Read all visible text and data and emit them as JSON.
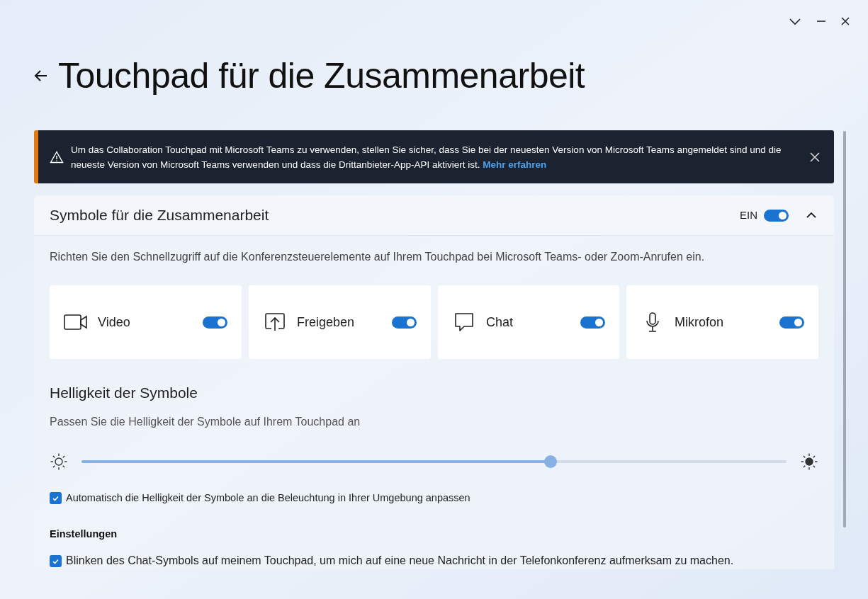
{
  "window": {
    "title": "Touchpad für die Zusammenarbeit"
  },
  "banner": {
    "message": "Um das Collaboration Touchpad mit Microsoft Teams zu verwenden, stellen Sie sicher, dass Sie bei der neuesten Version von Microsoft Teams angemeldet sind und die neueste Version von Microsoft Teams verwenden und dass die Drittanbieter-App-API aktiviert ist.",
    "link": "Mehr erfahren"
  },
  "section": {
    "title": "Symbole für die Zusammenarbeit",
    "state_label": "EIN",
    "on": true,
    "expanded": true,
    "description": "Richten Sie den Schnellzugriff auf die Konferenzsteuerelemente auf Ihrem Touchpad bei Microsoft Teams- oder Zoom-Anrufen ein.",
    "tiles": [
      {
        "kind": "video",
        "label": "Video",
        "on": true
      },
      {
        "kind": "share",
        "label": "Freigeben",
        "on": true
      },
      {
        "kind": "chat",
        "label": "Chat",
        "on": true
      },
      {
        "kind": "mic",
        "label": "Mikrofon",
        "on": true
      }
    ],
    "brightness": {
      "title": "Helligkeit der Symbole",
      "description": "Passen Sie die Helligkeit der Symbole auf Ihrem Touchpad an",
      "level": 0.665,
      "auto": {
        "label": "Automatisch die Helligkeit der Symbole an die Beleuchtung in Ihrer Umgebung anpassen",
        "checked": true
      }
    },
    "settings": {
      "title": "Einstellungen",
      "options": [
        {
          "label": "Blinken des Chat-Symbols auf meinem Touchpad, um mich auf eine neue Nachricht in der Telefonkonferenz aufmerksam zu machen.",
          "checked": true
        }
      ]
    }
  }
}
